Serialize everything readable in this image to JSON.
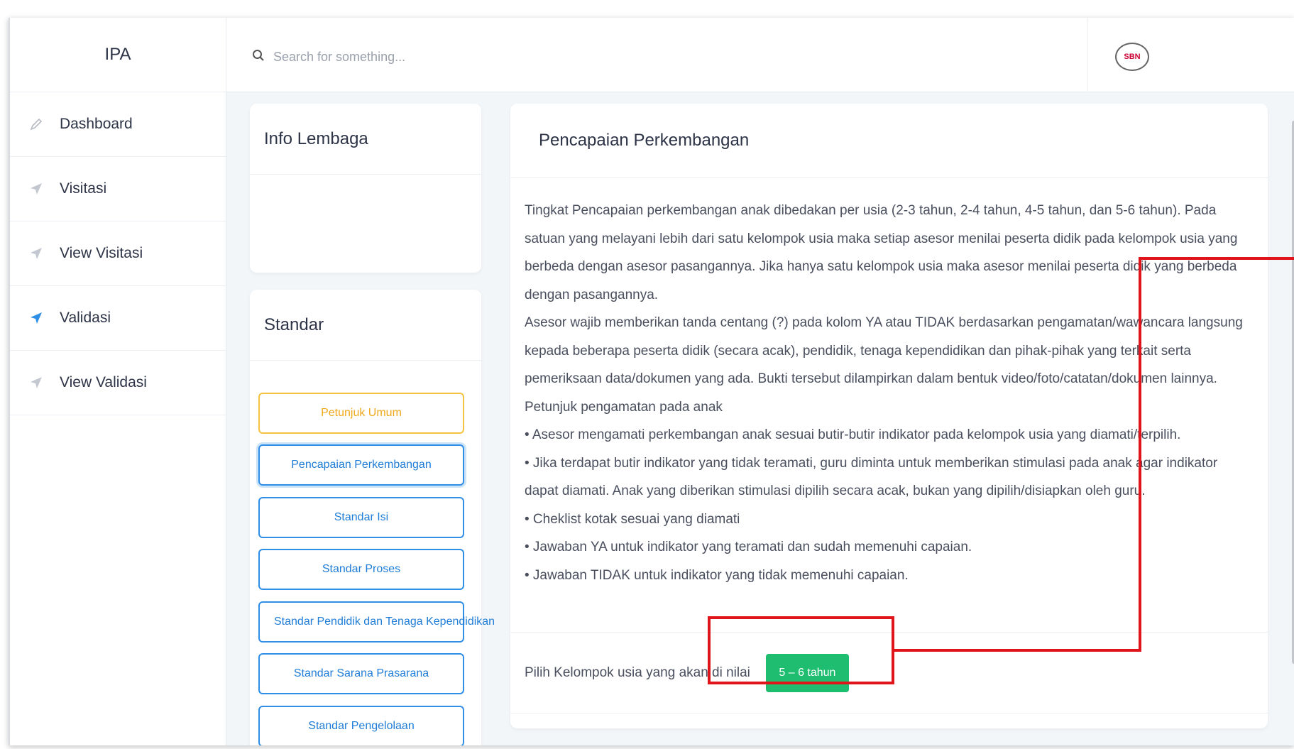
{
  "brand": "IPA",
  "sidebar": {
    "items": [
      {
        "label": "Dashboard",
        "icon": "pencil-icon"
      },
      {
        "label": "Visitasi",
        "icon": "send-icon"
      },
      {
        "label": "View Visitasi",
        "icon": "send-icon"
      },
      {
        "label": "Validasi",
        "icon": "send-icon"
      },
      {
        "label": "View Validasi",
        "icon": "send-icon"
      }
    ],
    "active_index": 3
  },
  "search": {
    "placeholder": "Search for something..."
  },
  "avatar_label": "SBN",
  "info_card": {
    "title": "Info Lembaga"
  },
  "standar_card": {
    "title": "Standar",
    "buttons": [
      "Petunjuk Umum",
      "Pencapaian Perkembangan",
      "Standar Isi",
      "Standar Proses",
      "Standar Pendidik dan Tenaga Kependidikan",
      "Standar Sarana Prasarana",
      "Standar Pengelolaan"
    ]
  },
  "main_card": {
    "title": "Pencapaian Perkembangan",
    "paragraphs": [
      "Tingkat Pencapaian perkembangan anak dibedakan per usia (2-3 tahun, 2-4 tahun, 4-5 tahun, dan 5-6 tahun). Pada satuan yang melayani lebih dari satu kelompok usia maka setiap asesor menilai peserta didik pada kelompok usia yang berbeda dengan asesor pasangannya. Jika hanya satu kelompok usia maka asesor menilai peserta didik yang berbeda dengan pasangannya.",
      "Asesor wajib memberikan tanda centang (?) pada kolom YA atau TIDAK berdasarkan pengamatan/wawancara langsung kepada beberapa peserta didik (secara acak), pendidik, tenaga kependidikan dan pihak-pihak yang terkait serta pemeriksaan data/dokumen yang ada. Bukti tersebut dilampirkan dalam bentuk video/foto/catatan/dokumen lainnya.",
      "Petunjuk pengamatan pada anak",
      "• Asesor mengamati perkembangan anak sesuai butir-butir indikator pada kelompok usia yang diamati/terpilih.",
      "• Jika terdapat butir indikator yang tidak teramati, guru diminta untuk memberikan stimulasi pada anak agar indikator dapat diamati. Anak yang diberikan stimulasi dipilih secara acak, bukan yang dipilih/disiapkan oleh guru.",
      "• Cheklist kotak sesuai yang diamati",
      "• Jawaban YA untuk indikator yang teramati dan sudah memenuhi capaian.",
      "• Jawaban TIDAK untuk indikator yang tidak memenuhi capaian."
    ],
    "select_label": "Pilih Kelompok usia yang akan di nilai",
    "age_button": "5 – 6 tahun"
  },
  "colors": {
    "accent": "#2f8fe6",
    "warning": "#f5c242",
    "success": "#1fbd6f",
    "annotation": "#e0141b"
  }
}
